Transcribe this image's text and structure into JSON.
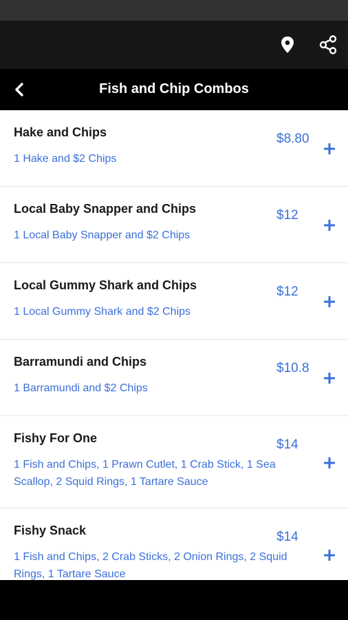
{
  "colors": {
    "accent": "#3b6fd9",
    "app_bar": "#171717",
    "title_bar": "#000000"
  },
  "app_bar": {
    "location_icon": "map-pin-icon",
    "share_icon": "share-icon"
  },
  "page": {
    "back_icon": "chevron-left-icon",
    "title": "Fish and Chip Combos"
  },
  "items": [
    {
      "name": "Hake and Chips",
      "description": "1 Hake and $2 Chips",
      "price": "$8.80"
    },
    {
      "name": "Local Baby Snapper and Chips",
      "description": "1 Local Baby Snapper and $2 Chips",
      "price": "$12"
    },
    {
      "name": "Local Gummy Shark and Chips",
      "description": "1 Local Gummy Shark and $2 Chips",
      "price": "$12"
    },
    {
      "name": "Barramundi and Chips",
      "description": "1 Barramundi and $2 Chips",
      "price": "$10.8"
    },
    {
      "name": "Fishy For One",
      "description": "1 Fish and Chips, 1 Prawn Cutlet, 1 Crab Stick, 1 Sea Scallop, 2 Squid Rings, 1 Tartare Sauce",
      "price": "$14"
    },
    {
      "name": "Fishy Snack",
      "description": "1 Fish and Chips, 2 Crab Sticks, 2 Onion Rings, 2 Squid Rings, 1 Tartare Sauce",
      "price": "$14"
    }
  ]
}
